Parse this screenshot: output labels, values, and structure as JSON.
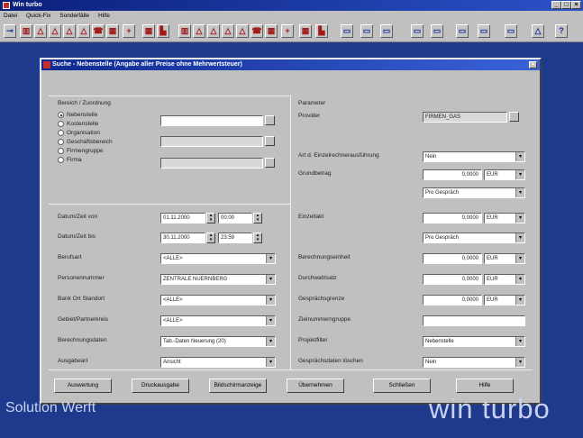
{
  "window": {
    "title": "Win turbo"
  },
  "menu": [
    "Datei",
    "Quick-Fix",
    "Sonderfälle",
    "Hilfe"
  ],
  "dialog": {
    "title": "Suche - Nebenstelle   (Angabe aller Preise ohne Mehrwertsteuer)"
  },
  "left": {
    "section_title": "Bereich / Zuordnung",
    "radios": [
      {
        "label": "Nebenstelle",
        "selected": true
      },
      {
        "label": "Kostenstelle",
        "selected": false
      },
      {
        "label": "Organisation",
        "selected": false
      },
      {
        "label": "Geschäftsbereich",
        "selected": false
      },
      {
        "label": "Firmengruppe",
        "selected": false
      },
      {
        "label": "Firma",
        "selected": false
      }
    ],
    "date_from_label": "Datum/Zeit von",
    "date_from": "01.11.2000",
    "time_from": "00:00",
    "date_to_label": "Datum/Zeit bis",
    "date_to": "30.11.2000",
    "time_to": "23:59",
    "rows": [
      {
        "label": "Berufsart",
        "value": "<ALLE>"
      },
      {
        "label": "Personennummer",
        "value": "ZENTRALE NUERNBERG"
      },
      {
        "label": "Bank Ort Standort",
        "value": "<ALLE>"
      },
      {
        "label": "Gebiet/Partnerkreis",
        "value": "<ALLE>"
      },
      {
        "label": "Berechnungsdaten",
        "value": "Tab.-Daten Neuerung (20)"
      },
      {
        "label": "Ausgabeart",
        "value": "Ansicht"
      }
    ]
  },
  "right": {
    "section_title": "Parameter",
    "provider_label": "Provider",
    "provider_value": "FIRMEN_GAS",
    "abrechnung_label": "Art d. Einzelrechnerausführung",
    "abrechnung_value": "Nein",
    "grundbetrag_label": "Grundbetrag",
    "grundbetrag_value": "0,0000",
    "grundbetrag_unit": "EUR",
    "grundbetrag_per": "Pro Gespräch",
    "einzeltakt_label": "Einzeltakt",
    "einzeltakt_value": "0,0000",
    "einzeltakt_unit": "EUR",
    "einzeltakt_per": "Pro Gespräch",
    "rows": [
      {
        "label": "Berechnungseinheit",
        "value": "0,0000",
        "unit": "EUR"
      },
      {
        "label": "Durchwahlsatz",
        "value": "0,0000",
        "unit": "EUR"
      },
      {
        "label": "Gesprächsgrenze",
        "value": "0,0000",
        "unit": "EUR"
      }
    ],
    "zielnummer_label": "Zielnummerngruppe",
    "projekt_label": "Projektfilter",
    "projekt_value": "Nebenstelle",
    "gespraech_label": "Gesprächsdaten löschen",
    "gespraech_value": "Nein"
  },
  "buttons": [
    "Auswertung",
    "Druckausgabe",
    "Bildschirmanzeige",
    "Übernehmen",
    "Schließen",
    "Hilfe"
  ],
  "branding": {
    "left": "Solution Werft",
    "right": "win turbo"
  }
}
